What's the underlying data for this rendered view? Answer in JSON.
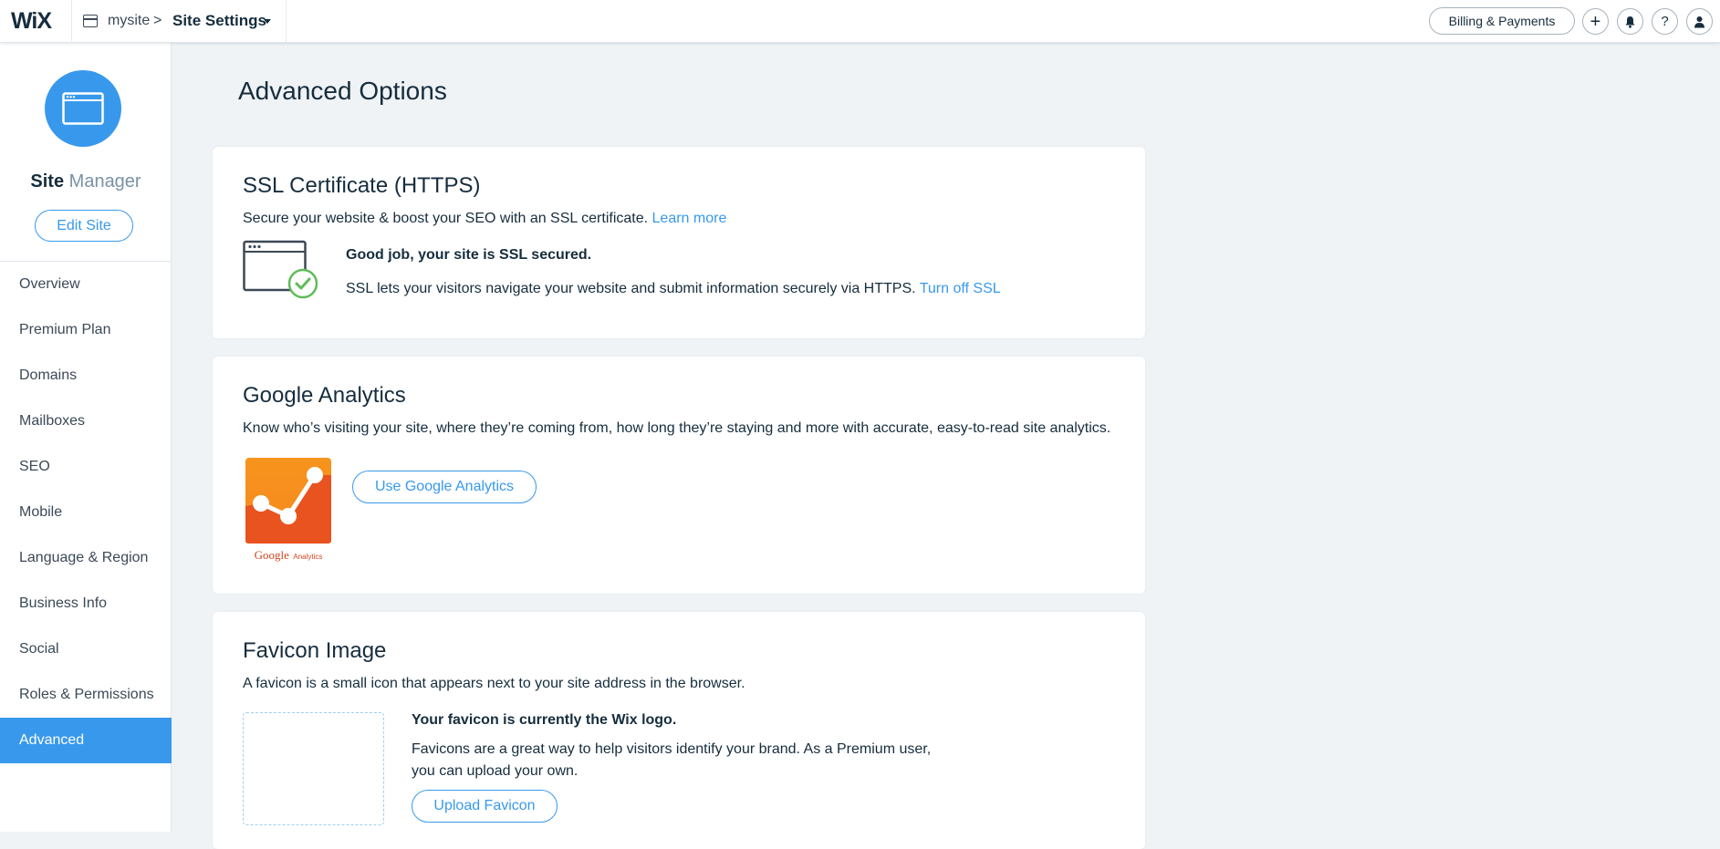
{
  "topbar": {
    "logo": "WiX",
    "site_name": "mysite",
    "chevron": ">",
    "current_section": "Site Settings",
    "billing_label": "Billing & Payments",
    "add_glyph": "+",
    "help_glyph": "?"
  },
  "sidebar": {
    "title_bold": "Site",
    "title_light": "Manager",
    "edit_site_label": "Edit Site",
    "items": [
      {
        "label": "Overview"
      },
      {
        "label": "Premium Plan"
      },
      {
        "label": "Domains"
      },
      {
        "label": "Mailboxes"
      },
      {
        "label": "SEO"
      },
      {
        "label": "Mobile"
      },
      {
        "label": "Language & Region"
      },
      {
        "label": "Business Info"
      },
      {
        "label": "Social"
      },
      {
        "label": "Roles & Permissions"
      },
      {
        "label": "Advanced"
      }
    ],
    "active_item": "Advanced"
  },
  "main": {
    "page_title": "Advanced Options",
    "ssl": {
      "title": "SSL Certificate (HTTPS)",
      "desc": "Secure your website & boost your SEO with an SSL certificate.",
      "learn_more": "Learn more",
      "status": "Good job, your site is SSL secured.",
      "detail": "SSL lets your visitors navigate your website and submit information securely via HTTPS.",
      "turn_off": "Turn off SSL"
    },
    "analytics": {
      "title": "Google Analytics",
      "desc": "Know who’s visiting your site, where they’re coming from, how long they’re staying and more with accurate, easy-to-read site analytics.",
      "logo_caption_main": "Google",
      "logo_caption_sub": "Analytics",
      "button": "Use Google Analytics"
    },
    "favicon": {
      "title": "Favicon Image",
      "desc": "A favicon is a small icon that appears next to your site address in the browser.",
      "status": "Your favicon is currently the Wix logo.",
      "detail": "Favicons are a great way to help visitors identify your brand. As a Premium user, you can upload your own.",
      "button": "Upload Favicon"
    }
  },
  "colors": {
    "accent": "#3899ec",
    "text": "#162d3d",
    "background": "#eff3f6",
    "success": "#60bc57",
    "ga_orange": "#f7941d",
    "ga_red": "#e8531f"
  }
}
